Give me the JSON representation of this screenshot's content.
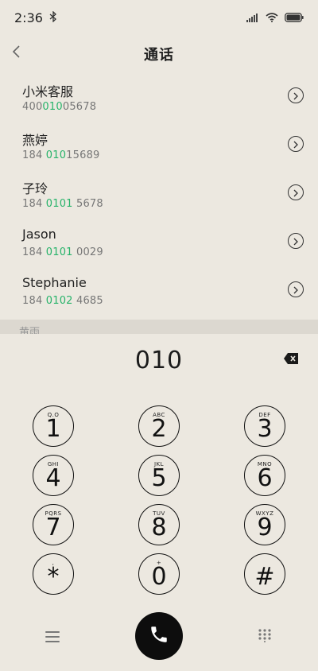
{
  "status": {
    "time": "2:36"
  },
  "header": {
    "title": "通话"
  },
  "contacts": [
    {
      "name": "小米客服",
      "num_pre": "400",
      "num_hl": "010",
      "num_post": "05678"
    },
    {
      "name": "燕婷",
      "num_pre": "184 ",
      "num_hl": "010",
      "num_post": "15689"
    },
    {
      "name": "子玲",
      "num_pre": "184 ",
      "num_hl": "0101",
      "num_post": " 5678"
    },
    {
      "name": "Jason",
      "num_pre": "184 ",
      "num_hl": "0101",
      "num_post": " 0029"
    },
    {
      "name": "Stephanie",
      "num_pre": "184 ",
      "num_hl": "0102",
      "num_post": " 4685"
    }
  ],
  "section": {
    "label": "黄雨"
  },
  "dialpad": {
    "input": "010",
    "keys": [
      {
        "digit": "1",
        "letters": "Q.O"
      },
      {
        "digit": "2",
        "letters": "ABC"
      },
      {
        "digit": "3",
        "letters": "DEF"
      },
      {
        "digit": "4",
        "letters": "GHI"
      },
      {
        "digit": "5",
        "letters": "JKL"
      },
      {
        "digit": "6",
        "letters": "MNO"
      },
      {
        "digit": "7",
        "letters": "PQRS"
      },
      {
        "digit": "8",
        "letters": "TUV"
      },
      {
        "digit": "9",
        "letters": "WXYZ"
      },
      {
        "digit": "*",
        "letters": ","
      },
      {
        "digit": "0",
        "letters": "+"
      },
      {
        "digit": "#",
        "letters": ""
      }
    ]
  },
  "colors": {
    "accent": "#27b36a",
    "background": "#ece8e0",
    "call": "#0d0d0d"
  },
  "icons": {
    "bluetooth": "bluetooth-icon",
    "signal": "signal-icon",
    "wifi": "wifi-icon",
    "battery": "battery-icon",
    "back": "back-icon",
    "detail": "chevron-right-icon",
    "delete": "backspace-icon",
    "menu": "menu-icon",
    "call": "phone-icon",
    "dialpad": "dialpad-icon"
  }
}
